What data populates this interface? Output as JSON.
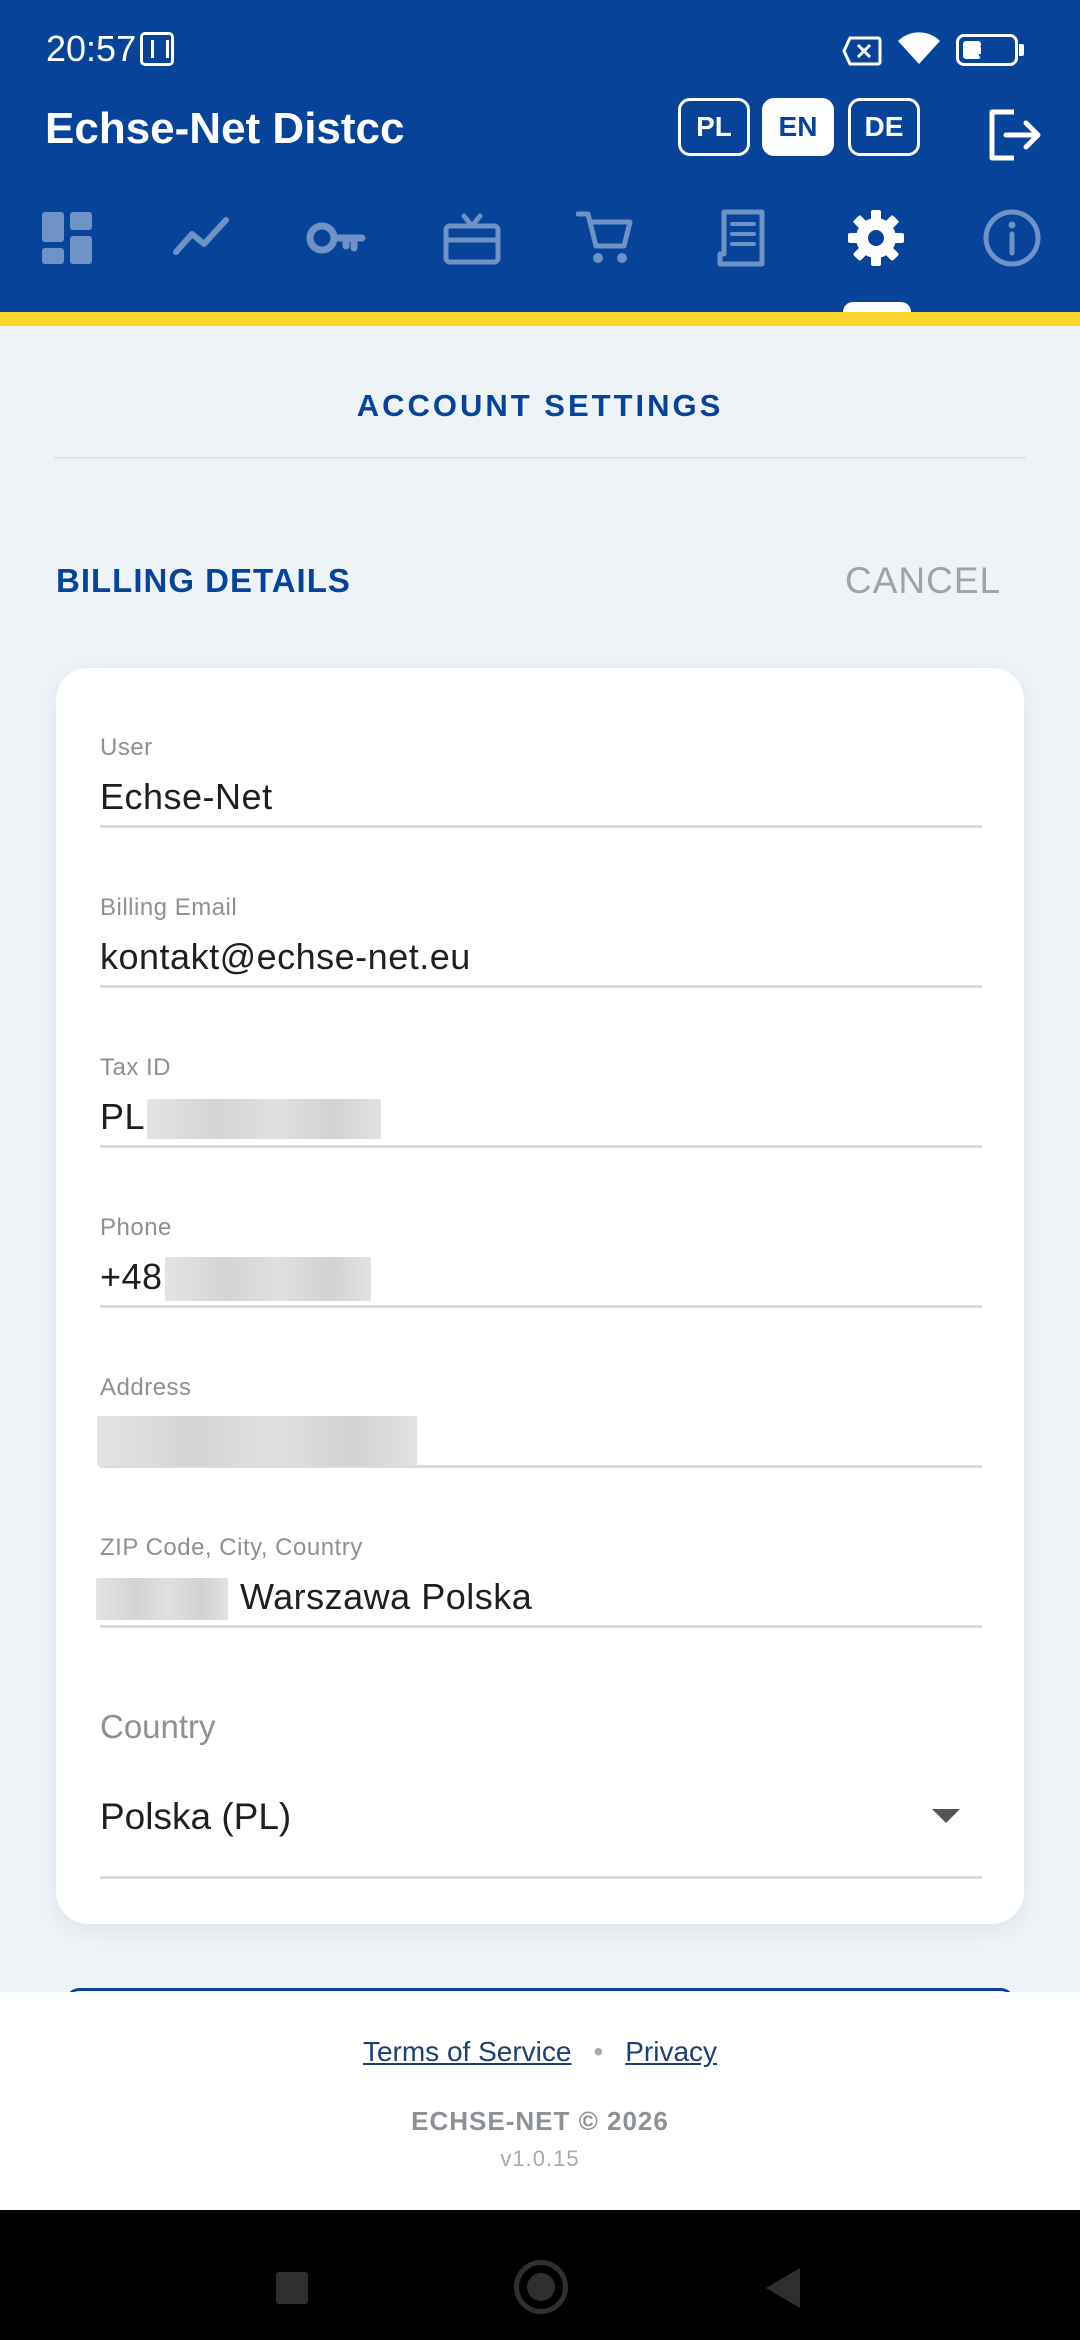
{
  "status_bar": {
    "time": "20:57",
    "battery_level": "34"
  },
  "header": {
    "app_title": "Echse-Net Distcc",
    "languages": [
      "PL",
      "EN",
      "DE"
    ],
    "active_language": "EN",
    "nav_icons": [
      "dashboard-icon",
      "chart-icon",
      "key-icon",
      "gift-card-icon",
      "cart-icon",
      "receipt-icon",
      "gear-icon",
      "info-icon"
    ],
    "active_nav": "gear-icon"
  },
  "page": {
    "title": "ACCOUNT SETTINGS",
    "section_title": "BILLING DETAILS",
    "cancel_label": "CANCEL"
  },
  "form": {
    "user_label": "User",
    "user_value": "Echse-Net",
    "email_label": "Billing Email",
    "email_value": "kontakt@echse-net.eu",
    "tax_label": "Tax ID",
    "tax_value_prefix": "PL",
    "phone_label": "Phone",
    "phone_value_prefix": "+48",
    "address_label": "Address",
    "zip_label": "ZIP Code, City, Country",
    "zip_value_suffix": "Warszawa Polska",
    "country_label": "Country",
    "country_value": "Polska (PL)"
  },
  "footer": {
    "terms_label": "Terms of Service",
    "separator": "•",
    "privacy_label": "Privacy",
    "copyright": "ECHSE-NET © 2026",
    "version": "v1.0.15"
  },
  "colors": {
    "brand_blue": "#064399",
    "accent_yellow": "#fbd52b",
    "background": "#eef3f8"
  }
}
